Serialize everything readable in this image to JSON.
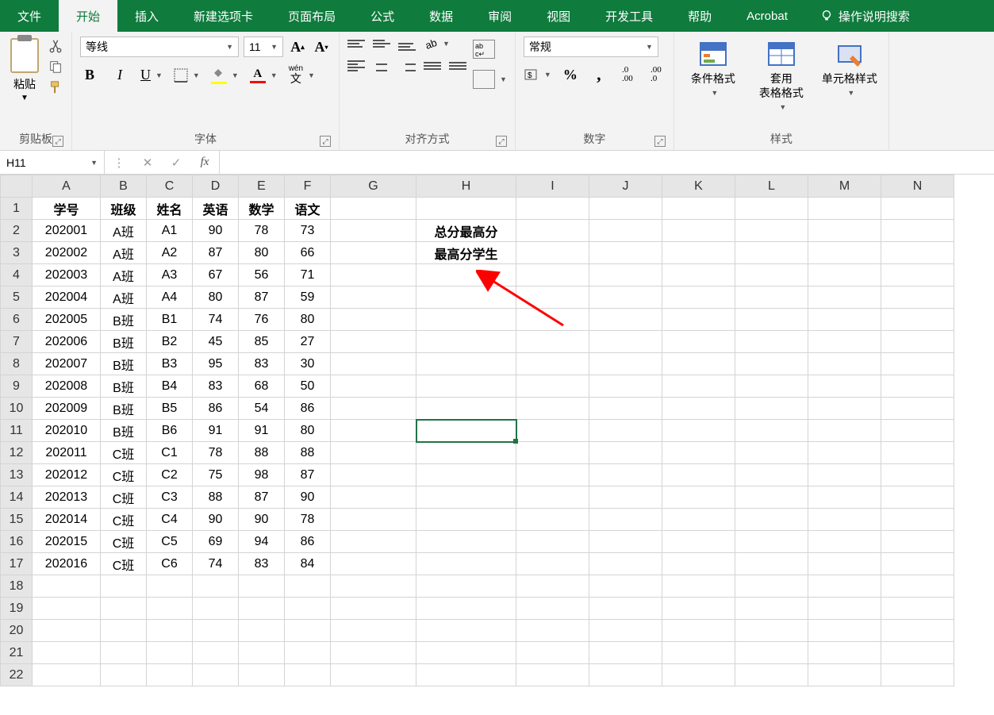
{
  "tabs": [
    "文件",
    "开始",
    "插入",
    "新建选项卡",
    "页面布局",
    "公式",
    "数据",
    "审阅",
    "视图",
    "开发工具",
    "帮助",
    "Acrobat"
  ],
  "active_tab": 1,
  "tellme": "操作说明搜索",
  "groups": {
    "clipboard": {
      "label": "剪贴板",
      "paste": "粘贴"
    },
    "font": {
      "label": "字体",
      "name": "等线",
      "size": "11"
    },
    "align": {
      "label": "对齐方式"
    },
    "number": {
      "label": "数字",
      "format": "常规"
    },
    "styles": {
      "label": "样式",
      "cond": "条件格式",
      "tablef": "套用\n表格格式",
      "cellf": "单元格样式"
    }
  },
  "namebox": "H11",
  "formula": "",
  "columns": [
    "A",
    "B",
    "C",
    "D",
    "E",
    "F",
    "G",
    "H",
    "I",
    "J",
    "K",
    "L",
    "M",
    "N"
  ],
  "headers": [
    "学号",
    "班级",
    "姓名",
    "英语",
    "数学",
    "语文"
  ],
  "rows": [
    [
      "202001",
      "A班",
      "A1",
      "90",
      "78",
      "73"
    ],
    [
      "202002",
      "A班",
      "A2",
      "87",
      "80",
      "66"
    ],
    [
      "202003",
      "A班",
      "A3",
      "67",
      "56",
      "71"
    ],
    [
      "202004",
      "A班",
      "A4",
      "80",
      "87",
      "59"
    ],
    [
      "202005",
      "B班",
      "B1",
      "74",
      "76",
      "80"
    ],
    [
      "202006",
      "B班",
      "B2",
      "45",
      "85",
      "27"
    ],
    [
      "202007",
      "B班",
      "B3",
      "95",
      "83",
      "30"
    ],
    [
      "202008",
      "B班",
      "B4",
      "83",
      "68",
      "50"
    ],
    [
      "202009",
      "B班",
      "B5",
      "86",
      "54",
      "86"
    ],
    [
      "202010",
      "B班",
      "B6",
      "91",
      "91",
      "80"
    ],
    [
      "202011",
      "C班",
      "C1",
      "78",
      "88",
      "88"
    ],
    [
      "202012",
      "C班",
      "C2",
      "75",
      "98",
      "87"
    ],
    [
      "202013",
      "C班",
      "C3",
      "88",
      "87",
      "90"
    ],
    [
      "202014",
      "C班",
      "C4",
      "90",
      "90",
      "78"
    ],
    [
      "202015",
      "C班",
      "C5",
      "69",
      "94",
      "86"
    ],
    [
      "202016",
      "C班",
      "C6",
      "74",
      "83",
      "84"
    ]
  ],
  "h2": "总分最高分",
  "h3": "最高分学生",
  "selected": {
    "row": 11,
    "col": "H"
  },
  "total_rows": 22
}
